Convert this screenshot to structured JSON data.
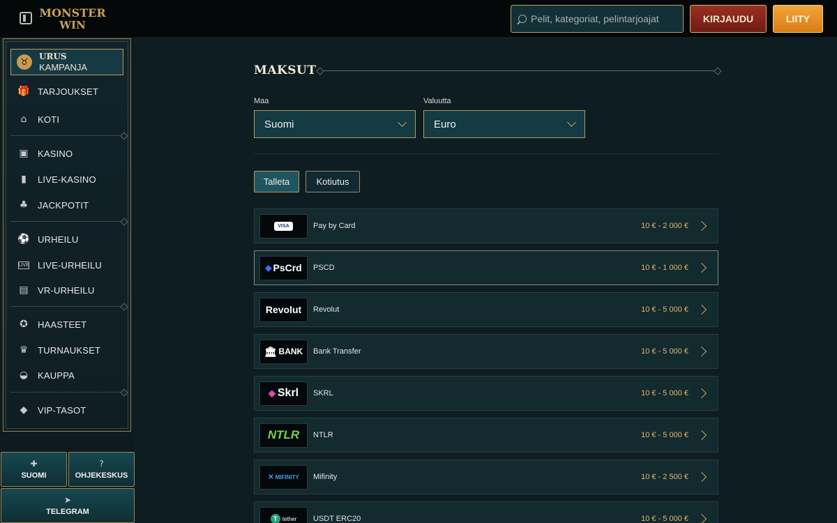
{
  "header": {
    "logo_line1": "MONSTER",
    "logo_line2": "WIN",
    "search_placeholder": "Pelit, kategoriat, pelintarjoajat",
    "login_label": "KIRJAUDU",
    "join_label": "LIITY"
  },
  "sidebar": {
    "promo": {
      "title": "URUS",
      "subtitle": "KAMPANJA",
      "icon": "bull-icon"
    },
    "items": [
      {
        "label": "TARJOUKSET",
        "icon": "gift-icon"
      },
      {
        "label": "KOTI",
        "icon": "home-icon"
      },
      {
        "label": "KASINO",
        "icon": "slot-machine-icon"
      },
      {
        "label": "LIVE-KASINO",
        "icon": "playing-card-icon"
      },
      {
        "label": "JACKPOTIT",
        "icon": "clover-icon"
      },
      {
        "label": "URHEILU",
        "icon": "ball-icon"
      },
      {
        "label": "LIVE-URHEILU",
        "icon": "live-icon"
      },
      {
        "label": "VR-URHEILU",
        "icon": "vr-sports-icon"
      },
      {
        "label": "HAASTEET",
        "icon": "medal-icon"
      },
      {
        "label": "TURNAUKSET",
        "icon": "trophy-icon"
      },
      {
        "label": "KAUPPA",
        "icon": "basket-icon"
      },
      {
        "label": "VIP-TASOT",
        "icon": "diamond-icon"
      }
    ],
    "language_label": "SUOMI",
    "help_label": "OHJEKESKUS",
    "telegram_label": "TELEGRAM"
  },
  "main": {
    "title": "MAKSUT",
    "country_label": "Maa",
    "country_value": "Suomi",
    "currency_label": "Valuutta",
    "currency_value": "Euro",
    "tabs": [
      "Talleta",
      "Kotiutus"
    ],
    "methods": [
      {
        "name": "Pay by Card",
        "range": "10 € - 2 000 €",
        "logo": "VISA"
      },
      {
        "name": "PSCD",
        "range": "10 € - 1 000 €",
        "logo": "PsCrd"
      },
      {
        "name": "Revolut",
        "range": "10 € - 5 000 €",
        "logo": "Revolut"
      },
      {
        "name": "Bank Transfer",
        "range": "10 € - 5 000 €",
        "logo": "BANK"
      },
      {
        "name": "SKRL",
        "range": "10 € - 5 000 €",
        "logo": "Skrl"
      },
      {
        "name": "NTLR",
        "range": "10 € - 5 000 €",
        "logo": "NTLR"
      },
      {
        "name": "Mifinity",
        "range": "10 € - 2 500 €",
        "logo": "MIFINITY"
      },
      {
        "name": "USDT ERC20",
        "range": "10 € - 5 000 €",
        "logo": "tether"
      }
    ]
  },
  "colors": {
    "background": "#0e1d21",
    "gold": "#c9a25a",
    "login": "#9a2f23",
    "join": "#f2a63b"
  }
}
